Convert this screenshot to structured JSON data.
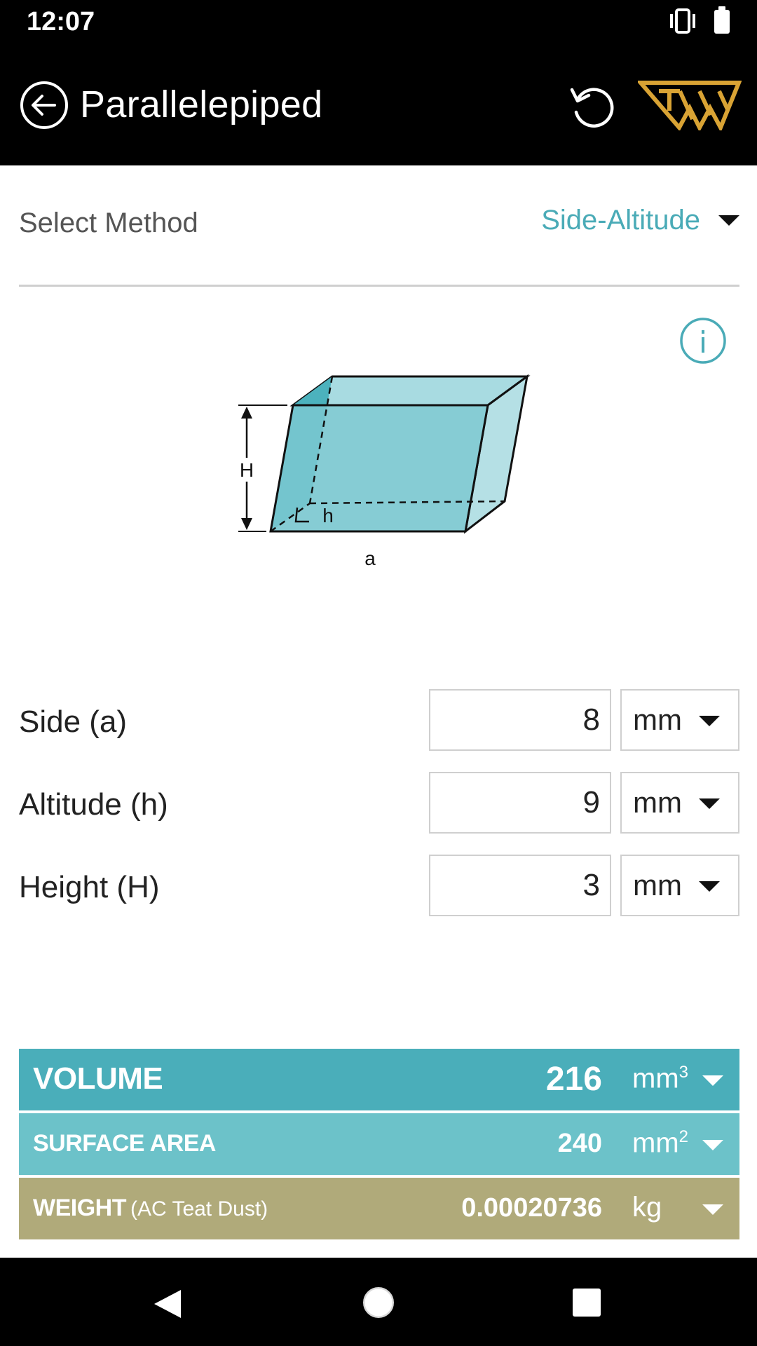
{
  "status": {
    "time": "12:07"
  },
  "app_bar": {
    "title": "Parallelepiped"
  },
  "method": {
    "label": "Select Method",
    "value": "Side-Altitude"
  },
  "diagram": {
    "labels": {
      "height": "H",
      "altitude": "h",
      "side": "a"
    }
  },
  "inputs": [
    {
      "label": "Side (a)",
      "value": "8",
      "unit": "mm"
    },
    {
      "label": "Altitude (h)",
      "value": "9",
      "unit": "mm"
    },
    {
      "label": "Height (H)",
      "value": "3",
      "unit": "mm"
    }
  ],
  "results": {
    "volume": {
      "label": "VOLUME",
      "value": "216",
      "unit": "mm",
      "unit_exp": "3"
    },
    "surface": {
      "label": "SURFACE AREA",
      "value": "240",
      "unit": "mm",
      "unit_exp": "2"
    },
    "weight": {
      "label": "WEIGHT",
      "material": "(AC Teat Dust)",
      "value": "0.00020736",
      "unit": "kg"
    }
  },
  "colors": {
    "accent": "#4aabb7",
    "volume_bg": "#4aaeba",
    "surface_bg": "#6cc2c9",
    "weight_bg": "#b0aa7a",
    "logo": "#d9a334"
  },
  "icons": {
    "back": "arrow-left-circle-icon",
    "reset": "refresh-icon",
    "info": "info-icon",
    "logo": "tw-logo"
  }
}
